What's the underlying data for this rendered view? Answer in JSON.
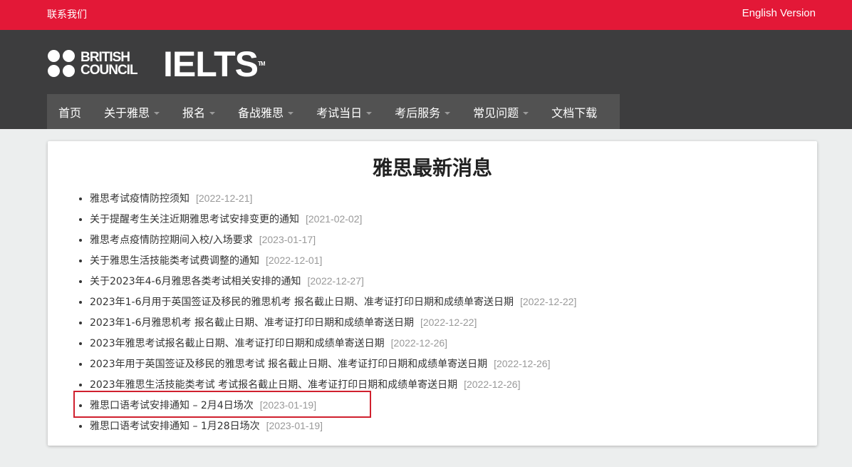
{
  "topbar": {
    "contact_label": "联系我们",
    "english_label": "English Version"
  },
  "logo": {
    "british_council_line1": "BRITISH",
    "british_council_line2": "COUNCIL",
    "ielts": "IELTS",
    "tm": "TM"
  },
  "nav": {
    "items": [
      {
        "label": "首页",
        "dropdown": false
      },
      {
        "label": "关于雅思",
        "dropdown": true
      },
      {
        "label": "报名",
        "dropdown": true
      },
      {
        "label": "备战雅思",
        "dropdown": true
      },
      {
        "label": "考试当日",
        "dropdown": true
      },
      {
        "label": "考后服务",
        "dropdown": true
      },
      {
        "label": "常见问题",
        "dropdown": true
      },
      {
        "label": "文档下载",
        "dropdown": false
      }
    ]
  },
  "main": {
    "title": "雅思最新消息",
    "news": [
      {
        "title": "雅思考试疫情防控须知",
        "date": "[2022-12-21]"
      },
      {
        "title": "关于提醒考生关注近期雅思考试安排变更的通知",
        "date": "[2021-02-02]"
      },
      {
        "title": "雅思考点疫情防控期间入校/入场要求",
        "date": "[2023-01-17]"
      },
      {
        "title": "关于雅思生活技能类考试费调整的通知",
        "date": "[2022-12-01]"
      },
      {
        "title": "关于2023年4-6月雅思各类考试相关安排的通知",
        "date": "[2022-12-27]"
      },
      {
        "title": "2023年1-6月用于英国签证及移民的雅思机考 报名截止日期、准考证打印日期和成绩单寄送日期",
        "date": "[2022-12-22]"
      },
      {
        "title": "2023年1-6月雅思机考 报名截止日期、准考证打印日期和成绩单寄送日期",
        "date": "[2022-12-22]"
      },
      {
        "title": "2023年雅思考试报名截止日期、准考证打印日期和成绩单寄送日期",
        "date": "[2022-12-26]"
      },
      {
        "title": "2023年用于英国签证及移民的雅思考试 报名截止日期、准考证打印日期和成绩单寄送日期",
        "date": "[2022-12-26]"
      },
      {
        "title": "2023年雅思生活技能类考试 考试报名截止日期、准考证打印日期和成绩单寄送日期",
        "date": "[2022-12-26]"
      },
      {
        "title": "雅思口语考试安排通知 – 2月4日场次",
        "date": "[2023-01-19]"
      },
      {
        "title": "雅思口语考试安排通知 – 1月28日场次",
        "date": "[2023-01-19]"
      }
    ]
  },
  "colors": {
    "topbar": "#e31837",
    "header": "#3d3d3e",
    "nav": "#525252",
    "highlight": "#d0202e"
  }
}
